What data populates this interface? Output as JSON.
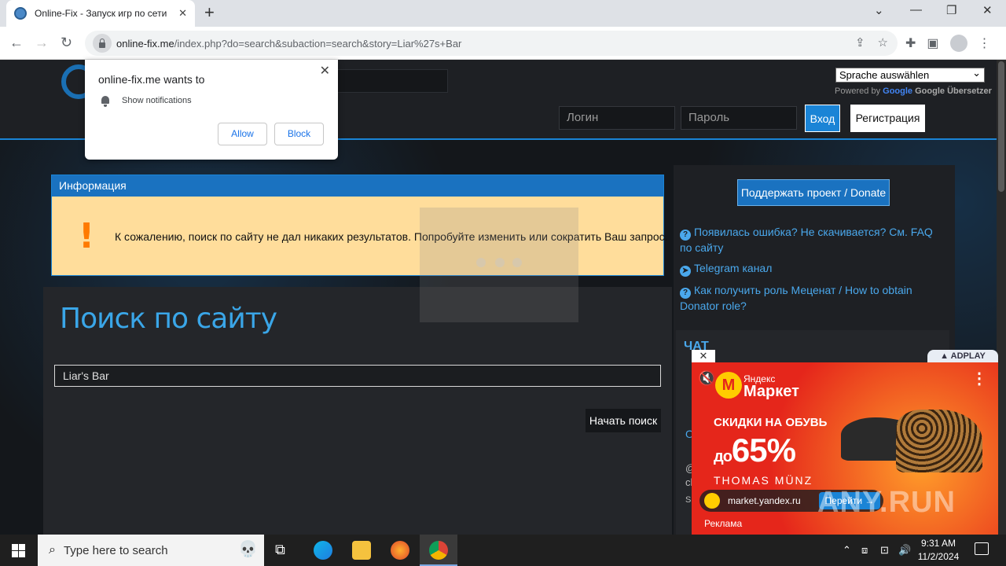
{
  "browser": {
    "tab_title": "Online-Fix - Запуск игр по сети",
    "tab_close": "✕",
    "new_tab": "+",
    "url_host": "online-fix.me",
    "url_path": "/index.php?do=search&subaction=search&story=Liar%27s+Bar",
    "minimize": "⌄",
    "min2": "—",
    "restore": "❐",
    "close": "✕"
  },
  "notification": {
    "title": "online-fix.me wants to",
    "text": "Show notifications",
    "allow": "Allow",
    "block": "Block",
    "close": "✕"
  },
  "header": {
    "language_select": "Sprache auswählen",
    "powered_by": "Powered by",
    "google": "Google",
    "translate": "Übersetzer",
    "login_placeholder": "Логин",
    "password_placeholder": "Пароль",
    "login_button": "Вход",
    "register_button": "Регистрация"
  },
  "info": {
    "heading": "Информация",
    "message": "К сожалению, поиск по сайту не дал никаких результатов. Попробуйте изменить или сократить Ваш запрос.",
    "icon": "!"
  },
  "search": {
    "title": "Поиск по сайту",
    "query": "Liar's Bar",
    "button": "Начать поиск"
  },
  "sidebar": {
    "donate": "Поддержать проект / Donate",
    "links": [
      {
        "text": "Появилась ошибка? Не скачивается? См. FAQ по сайту",
        "icon": "?"
      },
      {
        "text": "Telegram канал",
        "icon": "➤"
      },
      {
        "text": "Как получить роль Меценат / How to obtain Donator role?",
        "icon": "?"
      }
    ],
    "chat_title": "ЧАТ",
    "chat_frag1": "О",
    "chat_frag2": "@",
    "chat_frag3": "cl",
    "chat_frag4": "Sr"
  },
  "ad": {
    "close": "✕",
    "adplay": "▲ ADPLAY",
    "brand_small": "Яндекс",
    "brand_big": "Маркет",
    "line1": "СКИДКИ НА ОБУВЬ",
    "line2_prefix": "до",
    "line2_value": "65%",
    "thomas": "THOMAS MÜNZ",
    "site": "market.yandex.ru",
    "go": "Перейти →",
    "reklama": "Реклама",
    "menu": "⋮",
    "mute": "🔇"
  },
  "watermark": "ANY.RUN",
  "taskbar": {
    "search_placeholder": "Type here to search",
    "time": "9:31 AM",
    "date": "11/2/2024"
  },
  "colors": {
    "accent": "#1a84d6",
    "info_bg": "#ffdd9b",
    "title_blue": "#3aa6e8"
  }
}
